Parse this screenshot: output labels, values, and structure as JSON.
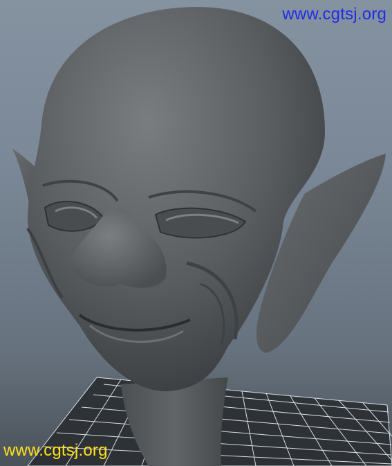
{
  "viewport": {
    "background_top": "#8592a0",
    "background_bottom": "#4a525a",
    "grid_color": "#e8eef2",
    "model_color": "#5a5d60"
  },
  "scene": {
    "subject": "sculpted-head-model",
    "floor": "perspective-grid"
  },
  "watermarks": {
    "top": {
      "text": "www.cgtsj.org",
      "color": "#1f2ee6"
    },
    "bottom": {
      "text": "www.cgtsj.org",
      "color": "#ffe21a"
    }
  }
}
